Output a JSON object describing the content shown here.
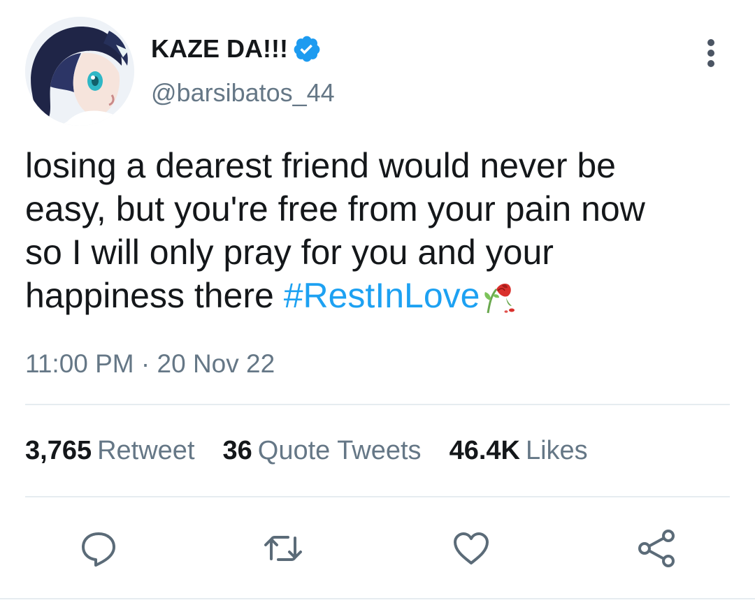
{
  "author": {
    "display_name": "KAZE DA!!!",
    "handle": "@barsibatos_44",
    "verified_icon": "verified-badge-icon",
    "verified_color": "#1d9bf0",
    "avatar_icon": "avatar-anime-character"
  },
  "tweet": {
    "text_lines": [
      "losing a dearest friend would never be",
      "easy, but you're free from your pain now",
      "so I will only pray for you and your",
      "happiness there "
    ],
    "hashtag": "#RestInLove",
    "emoji_icon": "wilted-rose-icon",
    "timestamp": "11:00 PM · 20 Nov 22"
  },
  "stats": {
    "retweets": {
      "count": "3,765",
      "label": "Retweet"
    },
    "quotes": {
      "count": "36",
      "label": "Quote Tweets"
    },
    "likes": {
      "count": "46.4K",
      "label": "Likes"
    }
  },
  "actions": [
    "reply-icon",
    "retweet-icon",
    "like-icon",
    "share-icon"
  ],
  "colors": {
    "text": "#14171a",
    "secondary": "#657786",
    "link": "#1da1f2",
    "divider": "#e6ecf0"
  }
}
